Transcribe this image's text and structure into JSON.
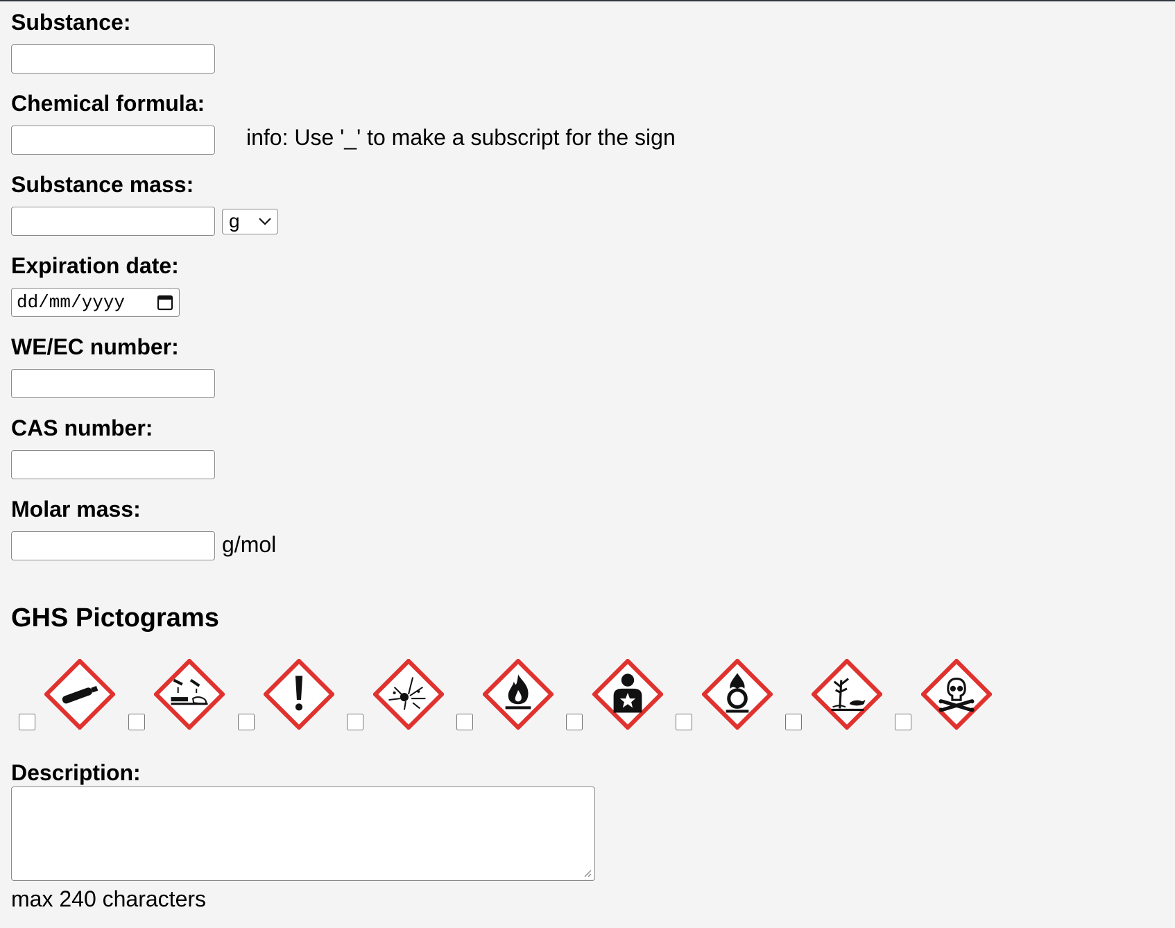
{
  "fields": {
    "substance": {
      "label": "Substance:",
      "value": ""
    },
    "formula": {
      "label": "Chemical formula:",
      "value": "",
      "info": "info: Use '_' to make a subscript for the sign"
    },
    "mass": {
      "label": "Substance mass:",
      "value": "",
      "unit_selected": "g"
    },
    "expiration": {
      "label": "Expiration date:",
      "placeholder": "dd/mm/yyyy"
    },
    "ec_number": {
      "label": "WE/EC number:",
      "value": ""
    },
    "cas_number": {
      "label": "CAS number:",
      "value": ""
    },
    "molar_mass": {
      "label": "Molar mass:",
      "value": "",
      "unit": "g/mol"
    }
  },
  "ghs": {
    "title": "GHS Pictograms",
    "pictograms": [
      {
        "icon": "gas-cylinder-icon",
        "checked": false
      },
      {
        "icon": "corrosion-icon",
        "checked": false
      },
      {
        "icon": "exclamation-mark-icon",
        "checked": false
      },
      {
        "icon": "exploding-bomb-icon",
        "checked": false
      },
      {
        "icon": "flame-icon",
        "checked": false
      },
      {
        "icon": "health-hazard-icon",
        "checked": false
      },
      {
        "icon": "flame-over-circle-icon",
        "checked": false
      },
      {
        "icon": "environment-icon",
        "checked": false
      },
      {
        "icon": "skull-crossbones-icon",
        "checked": false
      }
    ],
    "border_color": "#e0322e"
  },
  "description": {
    "label": "Description:",
    "value": "",
    "hint": "max 240 characters"
  }
}
